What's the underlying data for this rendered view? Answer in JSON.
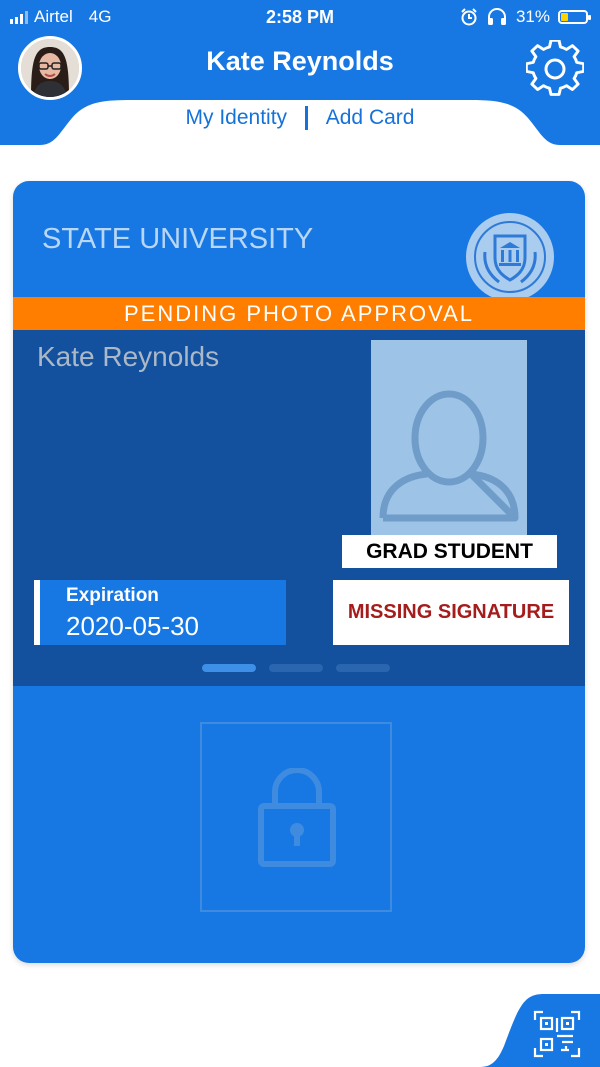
{
  "status_bar": {
    "carrier": "Airtel",
    "network": "4G",
    "time": "2:58 PM",
    "battery_percent_text": "31%",
    "battery_level": 0.31
  },
  "header": {
    "title": "Kate Reynolds",
    "tabs": [
      {
        "label": "My Identity"
      },
      {
        "label": "Add Card"
      }
    ]
  },
  "card": {
    "institution": "STATE UNIVERSITY",
    "banner": "PENDING PHOTO APPROVAL",
    "holder_name": "Kate Reynolds",
    "role": "GRAD STUDENT",
    "expiration_label": "Expiration",
    "expiration_date": "2020-05-30",
    "signature_status": "MISSING SIGNATURE",
    "page_indicator": {
      "count": 3,
      "active": 0
    }
  },
  "icons": {
    "avatar": "user-avatar",
    "settings": "gear-icon",
    "crest": "university-crest-icon",
    "placeholder": "person-placeholder-icon",
    "lock": "lock-icon",
    "qr": "qr-code-icon"
  },
  "colors": {
    "primary": "#1778e3",
    "dark_panel": "#13509d",
    "banner": "#ff7e00",
    "warning_text": "#a51c1c",
    "link": "#1572d9"
  }
}
